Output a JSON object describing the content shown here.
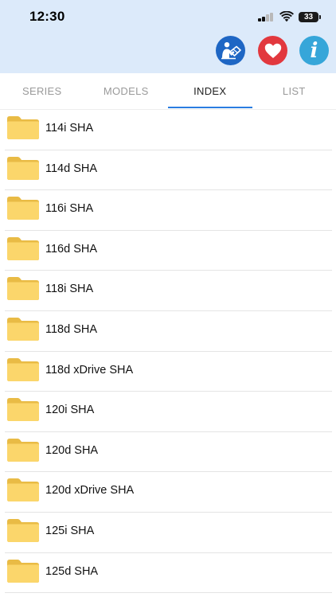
{
  "status_bar": {
    "time": "12:30",
    "battery_level": "33",
    "icons": [
      "cellular-signal-icon",
      "wifi-icon",
      "battery-icon"
    ]
  },
  "header": {
    "background": "#dceafa",
    "actions": [
      {
        "name": "reader-book-button",
        "icon": "person-reading-book-icon",
        "color": "#1e66c4"
      },
      {
        "name": "favorites-button",
        "icon": "heart-icon",
        "color": "#e2383e"
      },
      {
        "name": "info-button",
        "icon": "info-icon",
        "glyph": "i",
        "color": "#36a6d9"
      }
    ]
  },
  "tabs": [
    {
      "label": "SERIES",
      "active": false
    },
    {
      "label": "MODELS",
      "active": false
    },
    {
      "label": "INDEX",
      "active": true
    },
    {
      "label": "LIST",
      "active": false
    }
  ],
  "accent_color": "#2a7de1",
  "folder_color": "#fbd66b",
  "items": [
    {
      "label": "114i SHA"
    },
    {
      "label": "114d SHA"
    },
    {
      "label": "116i SHA"
    },
    {
      "label": "116d SHA"
    },
    {
      "label": "118i SHA"
    },
    {
      "label": "118d SHA"
    },
    {
      "label": "118d xDrive SHA"
    },
    {
      "label": "120i SHA"
    },
    {
      "label": "120d SHA"
    },
    {
      "label": "120d xDrive SHA"
    },
    {
      "label": "125i SHA"
    },
    {
      "label": "125d SHA"
    }
  ]
}
